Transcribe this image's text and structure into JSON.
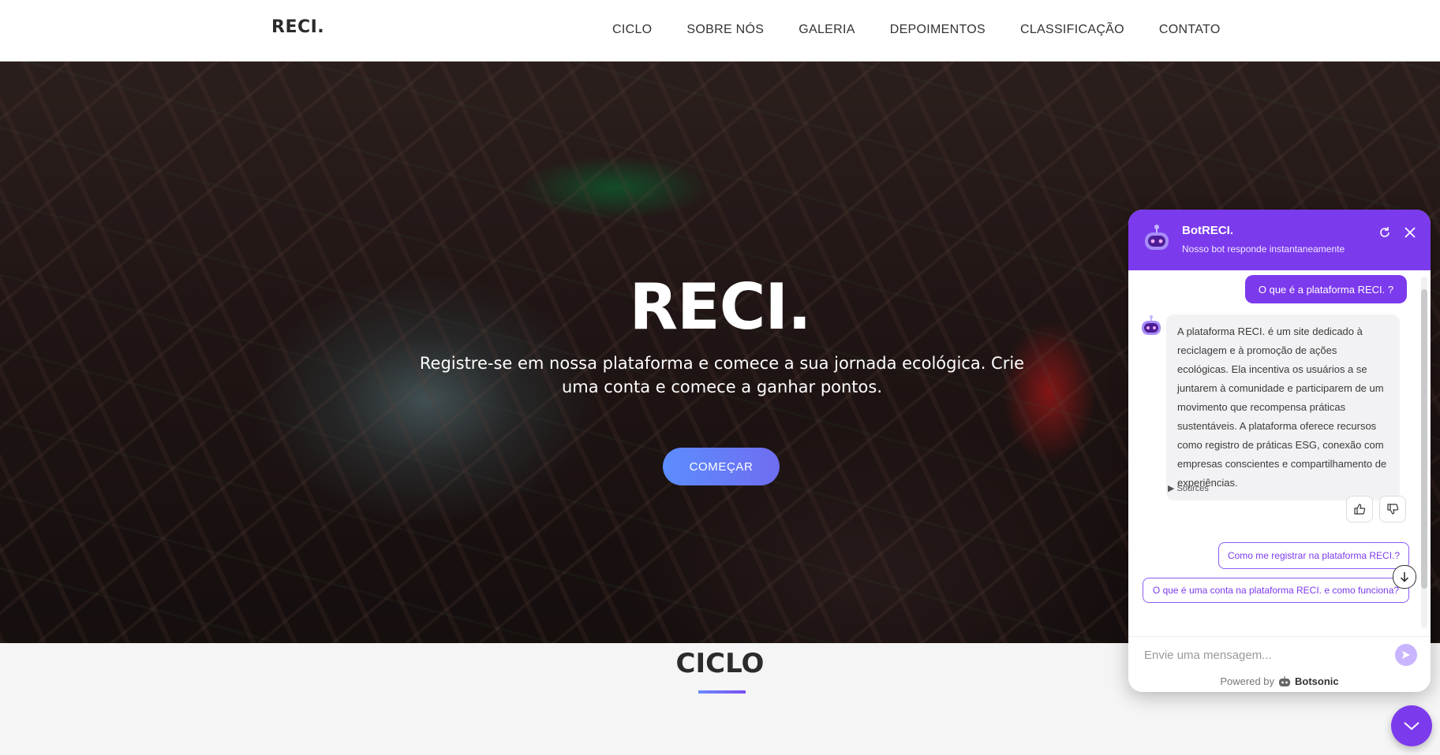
{
  "header": {
    "brand": "RECI.",
    "nav": [
      "CICLO",
      "SOBRE NÓS",
      "GALERIA",
      "DEPOIMENTOS",
      "CLASSIFICAÇÃO",
      "CONTATO"
    ]
  },
  "hero": {
    "title": "RECI.",
    "subtitle": "Registre-se em nossa plataforma e comece a sua jornada ecológica. Crie uma conta e comece a ganhar pontos.",
    "cta_label": "COMEÇAR"
  },
  "section": {
    "title": "CICLO"
  },
  "chat": {
    "bot_name": "BotRECI.",
    "bot_description": "Nosso bot responde instantaneamente",
    "user_message": "O que é a plataforma RECI. ?",
    "bot_message": "A plataforma RECI. é um site dedicado à reciclagem e à promoção de ações ecológicas. Ela incentiva os usuários a se juntarem à comunidade e participarem de um movimento que recompensa práticas sustentáveis. A plataforma oferece recursos como registro de práticas ESG, conexão com empresas conscientes e compartilhamento de experiências.",
    "sources_label": "Sources",
    "suggestions": [
      "Como me registrar na plataforma RECI.?",
      "O que é uma conta na plataforma RECI. e como funciona?"
    ],
    "input_placeholder": "Envie uma mensagem...",
    "powered_by": "Powered by",
    "powered_brand": "Botsonic"
  },
  "colors": {
    "accent": "#7c3aed",
    "cta_start": "#5c8dff",
    "cta_end": "#6f6df0"
  }
}
